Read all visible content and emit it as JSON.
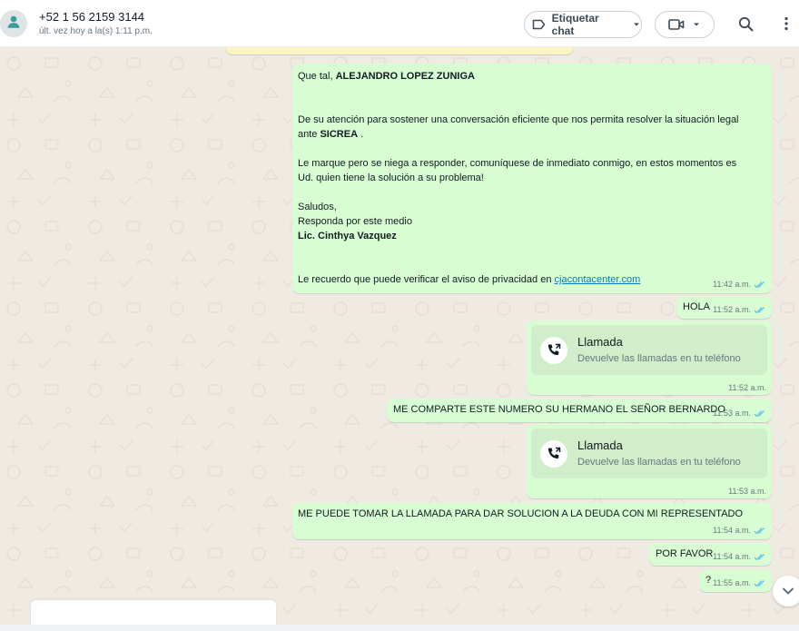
{
  "header": {
    "contact_name": "+52 1 56 2159 3144",
    "last_seen": "últ. vez hoy a la(s) 1:11 p.m.",
    "label_button": "Etiquetar chat",
    "icons": {
      "avatar": "person-icon",
      "label": "label-icon",
      "video": "video-call-icon",
      "search": "search-icon",
      "menu": "more-vertical-icon"
    }
  },
  "messages": {
    "m1": {
      "greeting_prefix": "Que tal, ",
      "greeting_name": "ALEJANDRO LOPEZ ZUNIGA",
      "para1_line1": "De su atención para sostener una conversación eficiente que nos permita resolver la situación legal",
      "para1_line2_prefix": "ante ",
      "para1_line2_bold": "SICREA",
      "para1_line2_suffix": " .",
      "para2_line1": "Le marque pero se niega a responder, comuníquese de inmediato conmigo, en estos momentos es",
      "para2_line2": "Ud. quien tiene la solución a su problema!",
      "saludos": "Saludos,",
      "responda": "Responda por este medio",
      "signature": "Lic. Cinthya Vazquez",
      "privacy_prefix": "Le recuerdo que puede verificar el aviso de privacidad en ",
      "privacy_link": "cjacontacenter.com",
      "time": "11:42 a.m."
    },
    "m2": {
      "text": "HOLA",
      "time": "11:52 a.m."
    },
    "m3": {
      "title": "Llamada",
      "subtitle": "Devuelve las llamadas en tu teléfono",
      "time": "11:52 a.m."
    },
    "m4": {
      "text": "ME COMPARTE ESTE NUMERO SU HERMANO EL SEÑOR BERNARDO",
      "time": "11:53 a.m."
    },
    "m5": {
      "title": "Llamada",
      "subtitle": "Devuelve las llamadas en tu teléfono",
      "time": "11:53 a.m."
    },
    "m6": {
      "text": "ME PUEDE TOMAR LA LLAMADA PARA DAR SOLUCION A LA DEUDA CON MI REPRESENTADO",
      "time": "11:54 a.m."
    },
    "m7": {
      "text": "POR FAVOR",
      "time": "11:54 a.m."
    },
    "m8": {
      "text": "?",
      "time": "11:55 a.m."
    }
  },
  "colors": {
    "outgoing_bubble": "#d9fdd3",
    "chat_background": "#efeae2",
    "read_tick": "#53bdeb"
  }
}
